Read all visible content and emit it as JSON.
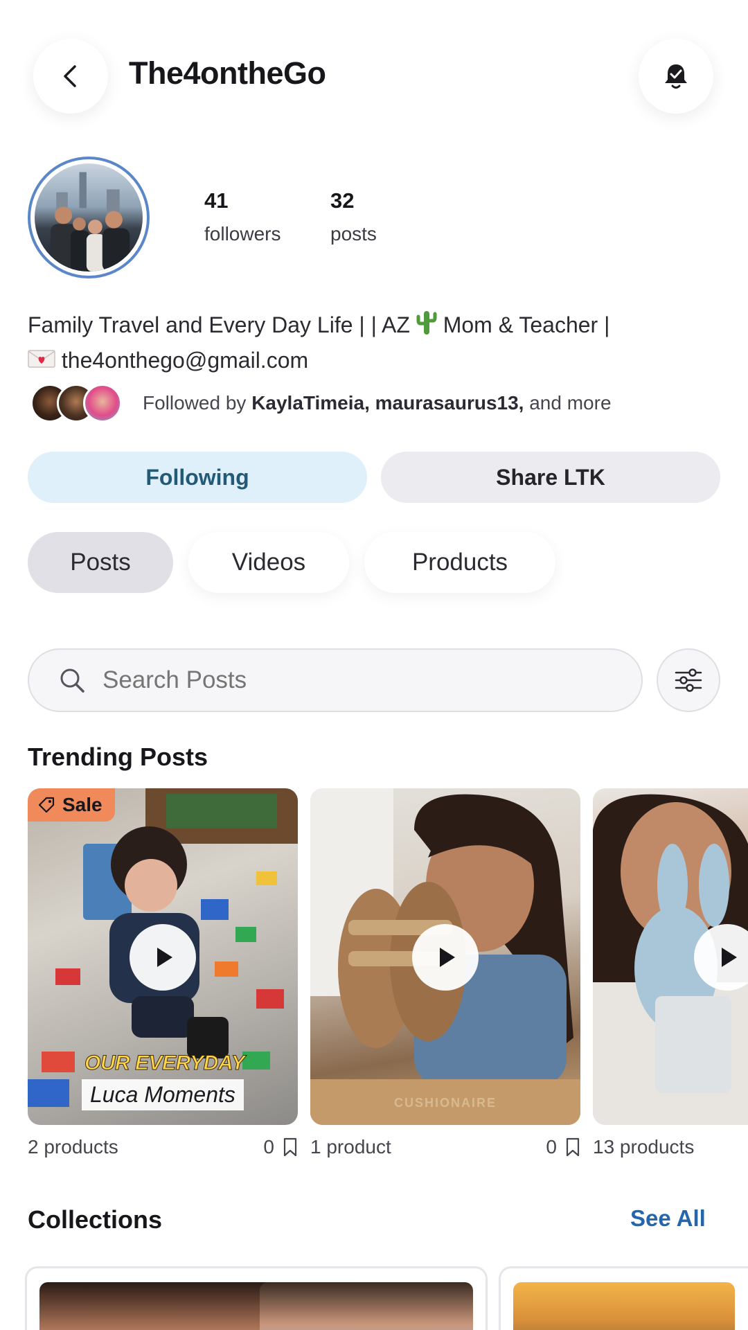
{
  "header": {
    "title": "The4ontheGo",
    "back_icon": "chevron-left-icon",
    "notification_icon": "bell-check-icon"
  },
  "profile": {
    "followers_count": "41",
    "followers_label": "followers",
    "posts_count": "32",
    "posts_label": "posts",
    "bio_line1_a": "Family Travel and Every Day Life | | AZ",
    "bio_line1_b": "Mom & Teacher |",
    "bio_line2": "the4onthego@gmail.com",
    "followed_by_prefix": "Followed by",
    "followed_by_names": "KaylaTimeia, maurasaurus13,",
    "followed_by_suffix": "and more"
  },
  "actions": {
    "following_label": "Following",
    "share_label": "Share LTK"
  },
  "tabs": [
    {
      "label": "Posts",
      "active": true
    },
    {
      "label": "Videos",
      "active": false
    },
    {
      "label": "Products",
      "active": false
    }
  ],
  "search": {
    "placeholder": "Search Posts"
  },
  "trending": {
    "title": "Trending Posts",
    "posts": [
      {
        "badge": "Sale",
        "caption_top": "OUR EVERYDAY",
        "caption_bottom": "Luca Moments",
        "products": "2 products",
        "saves": "0"
      },
      {
        "box_text": "CUSHIONAIRE",
        "products": "1 product",
        "saves": "0"
      },
      {
        "products": "13 products"
      }
    ]
  },
  "collections": {
    "title": "Collections",
    "see_all": "See All"
  },
  "colors": {
    "accent_blue": "#2466ad",
    "following_bg": "#dff0fb",
    "sale_badge": "#f08a5a"
  }
}
